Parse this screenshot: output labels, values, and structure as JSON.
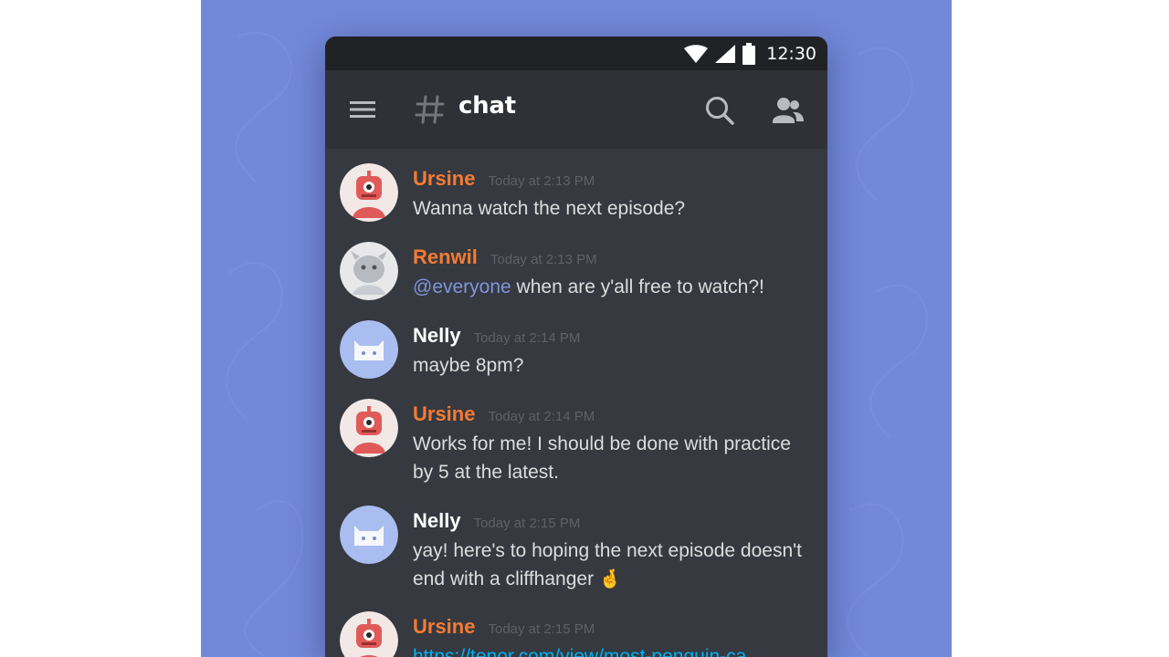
{
  "statusbar": {
    "time": "12:30",
    "wifi_icon": "wifi-icon",
    "signal_icon": "cell-signal-icon",
    "battery_icon": "battery-icon"
  },
  "appbar": {
    "channel_name": "chat",
    "menu_icon": "hamburger-menu-icon",
    "hash_icon": "hash-icon",
    "search_icon": "search-icon",
    "members_icon": "members-icon"
  },
  "colors": {
    "backdrop": "#7289da",
    "chat_background": "#36393f",
    "appbar": "#2f3136",
    "statusbar": "#202225",
    "username_orange": "#f47b34",
    "username_white": "#ffffff",
    "mention": "#7f95de",
    "link": "#00b0f4"
  },
  "messages": [
    {
      "username": "Ursine",
      "timestamp": "Today at 2:13 PM",
      "text": "Wanna watch the next episode?",
      "avatar": "red-robot-avatar"
    },
    {
      "username": "Renwil",
      "timestamp": "Today at 2:13 PM",
      "mention": "@everyone",
      "text": " when are y'all free to watch?!",
      "avatar": "gray-creature-avatar"
    },
    {
      "username": "Nelly",
      "timestamp": "Today at 2:14 PM",
      "text": "maybe 8pm?",
      "avatar": "blue-cat-avatar"
    },
    {
      "username": "Ursine",
      "timestamp": "Today at 2:14 PM",
      "text": "Works for me! I should be done with practice by 5 at the latest.",
      "avatar": "red-robot-avatar"
    },
    {
      "username": "Nelly",
      "timestamp": "Today at 2:15 PM",
      "text": "yay! here's to hoping the next episode doesn't end with a cliffhanger",
      "emoji": "🤞",
      "avatar": "blue-cat-avatar"
    },
    {
      "username": "Ursine",
      "timestamp": "Today at 2:15 PM",
      "link": "https://tenor.com/view/most-penguin-ca",
      "avatar": "red-robot-avatar"
    }
  ]
}
